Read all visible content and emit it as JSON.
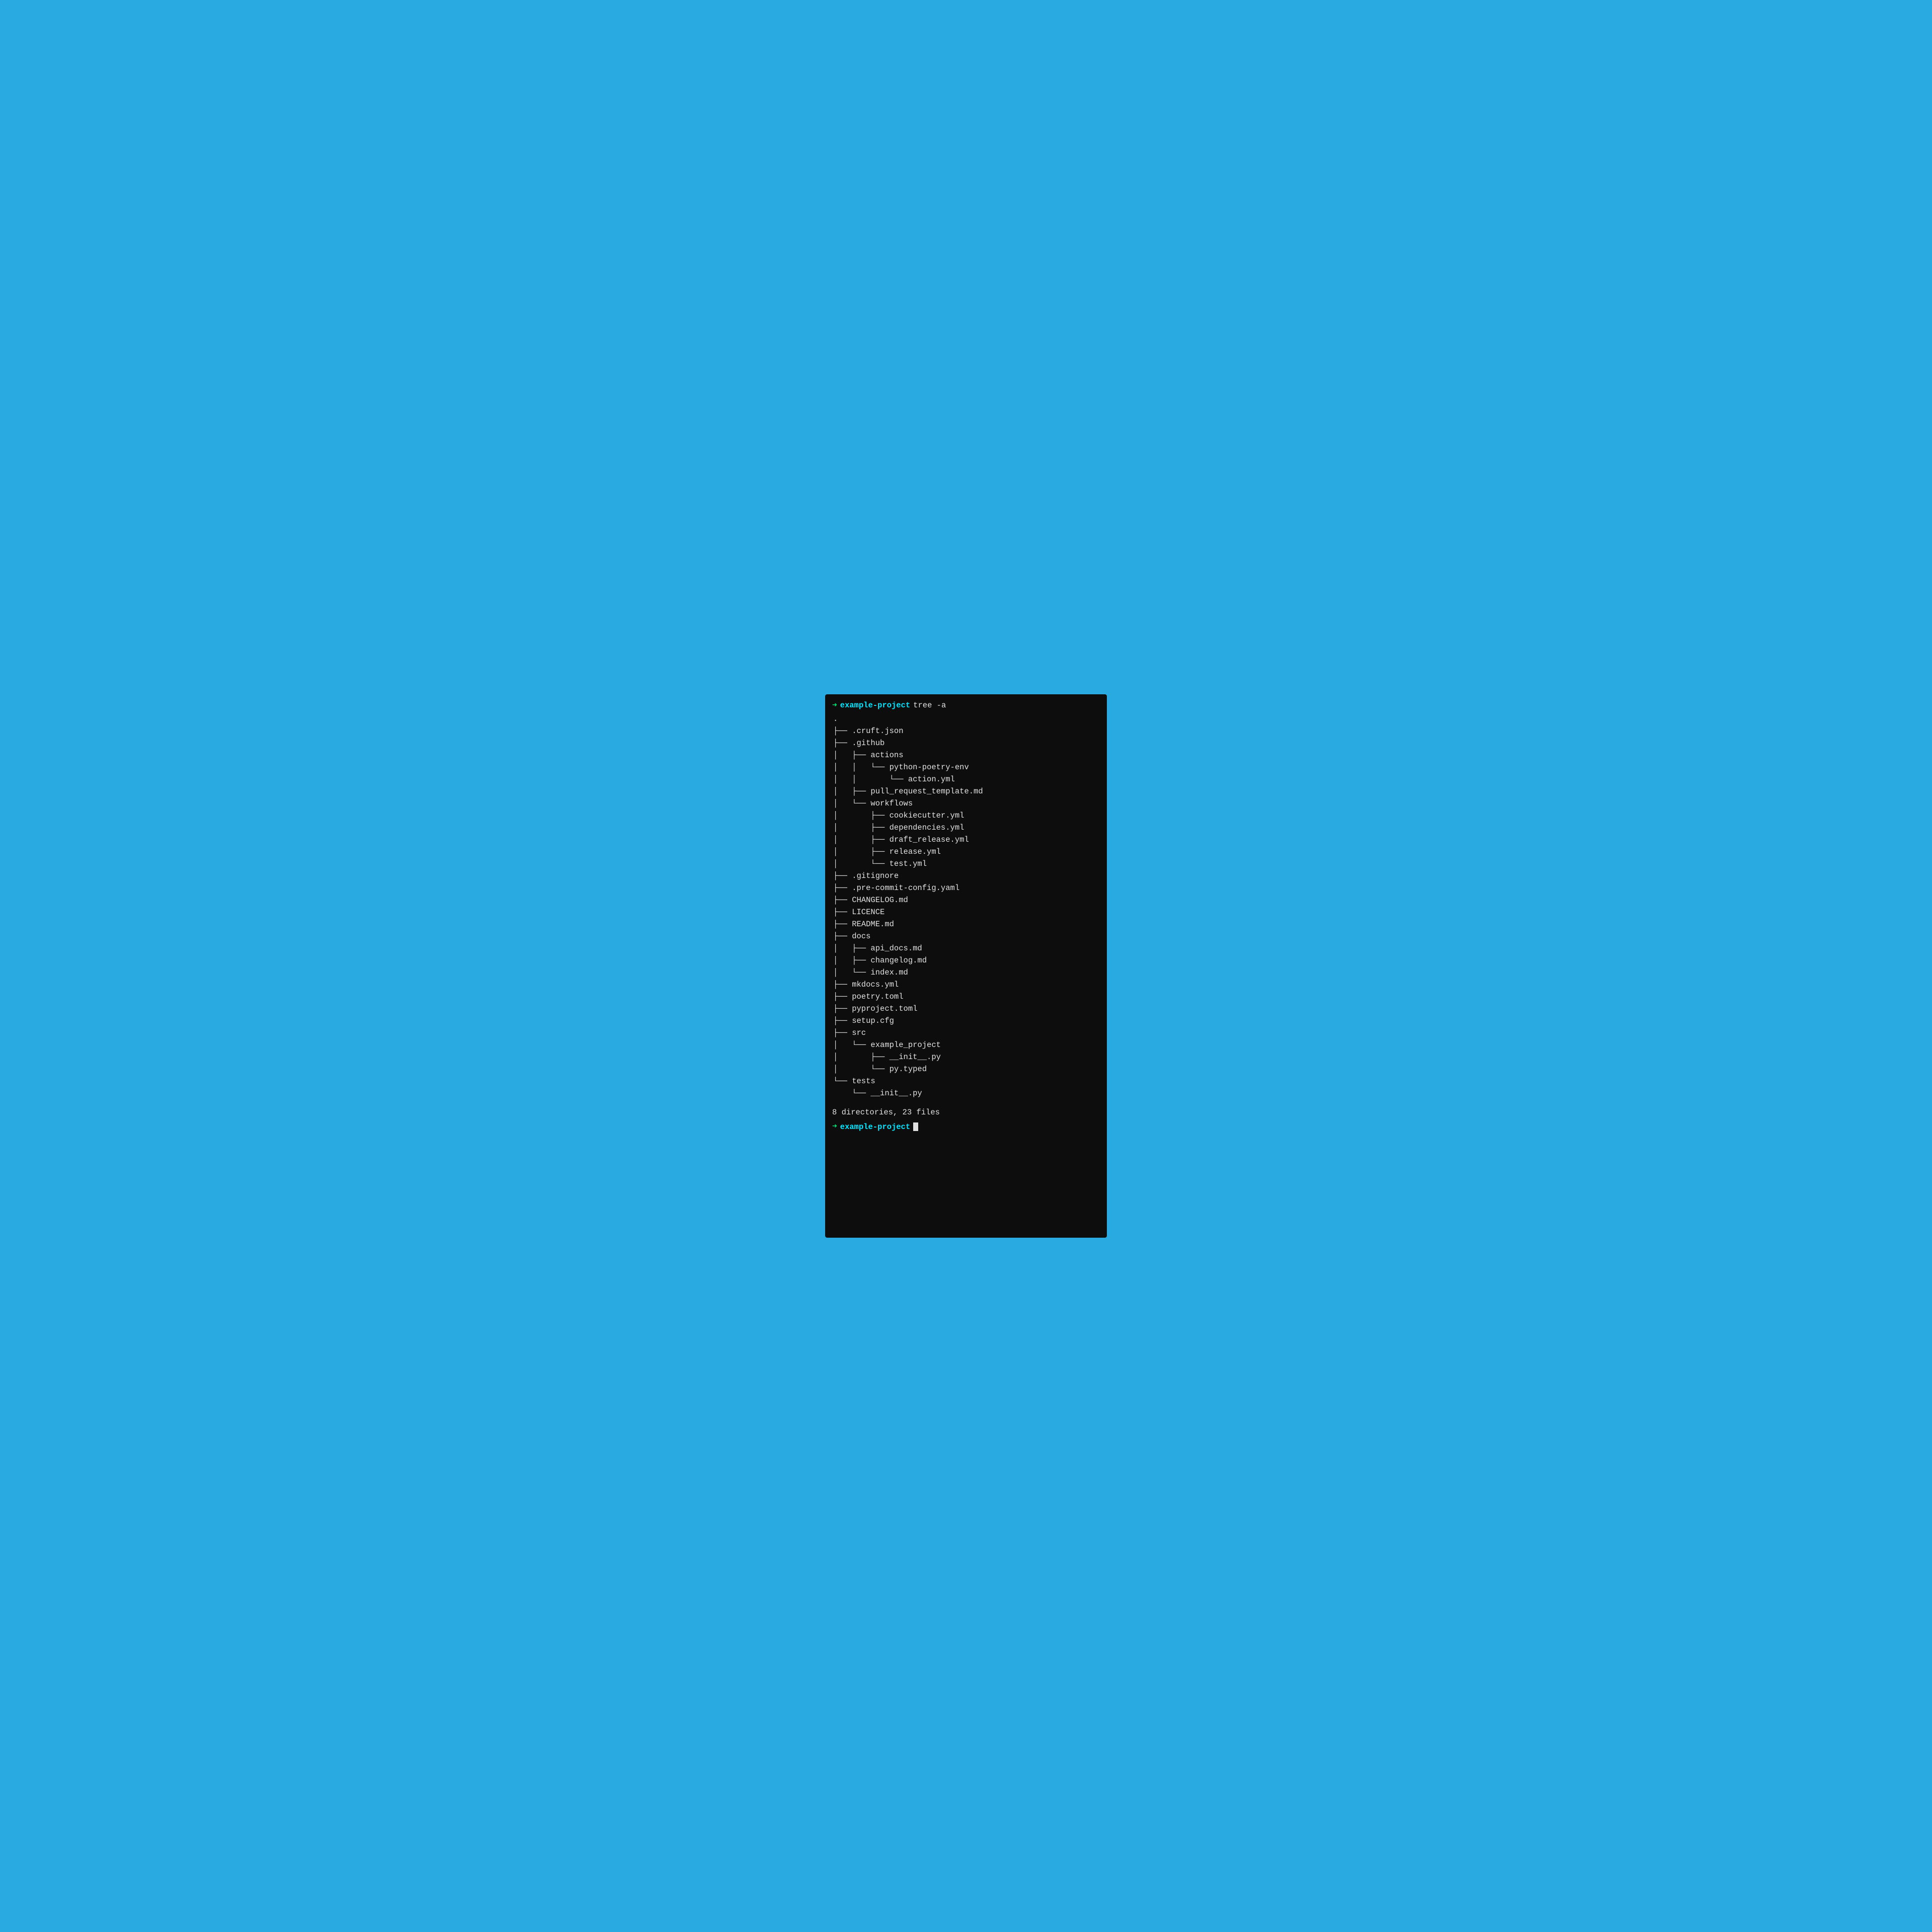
{
  "terminal": {
    "background": "#0d0d0d",
    "prompt_arrow": "➜",
    "prompt_dir": "example-project",
    "prompt_cmd": "tree -a",
    "tree_lines": [
      ".",
      "├── .cruft.json",
      "├── .github",
      "│   ├── actions",
      "│   │   └── python-poetry-env",
      "│   │       └── action.yml",
      "│   ├── pull_request_template.md",
      "│   └── workflows",
      "│       ├── cookiecutter.yml",
      "│       ├── dependencies.yml",
      "│       ├── draft_release.yml",
      "│       ├── release.yml",
      "│       └── test.yml",
      "├── .gitignore",
      "├── .pre-commit-config.yaml",
      "├── CHANGELOG.md",
      "├── LICENCE",
      "├── README.md",
      "├── docs",
      "│   ├── api_docs.md",
      "│   ├── changelog.md",
      "│   └── index.md",
      "├── mkdocs.yml",
      "├── poetry.toml",
      "├── pyproject.toml",
      "├── setup.cfg",
      "├── src",
      "│   └── example_project",
      "│       ├── __init__.py",
      "│       └── py.typed",
      "└── tests",
      "    └── __init__.py"
    ],
    "summary": "8 directories, 23 files",
    "prompt_dir_bottom": "example-project"
  }
}
